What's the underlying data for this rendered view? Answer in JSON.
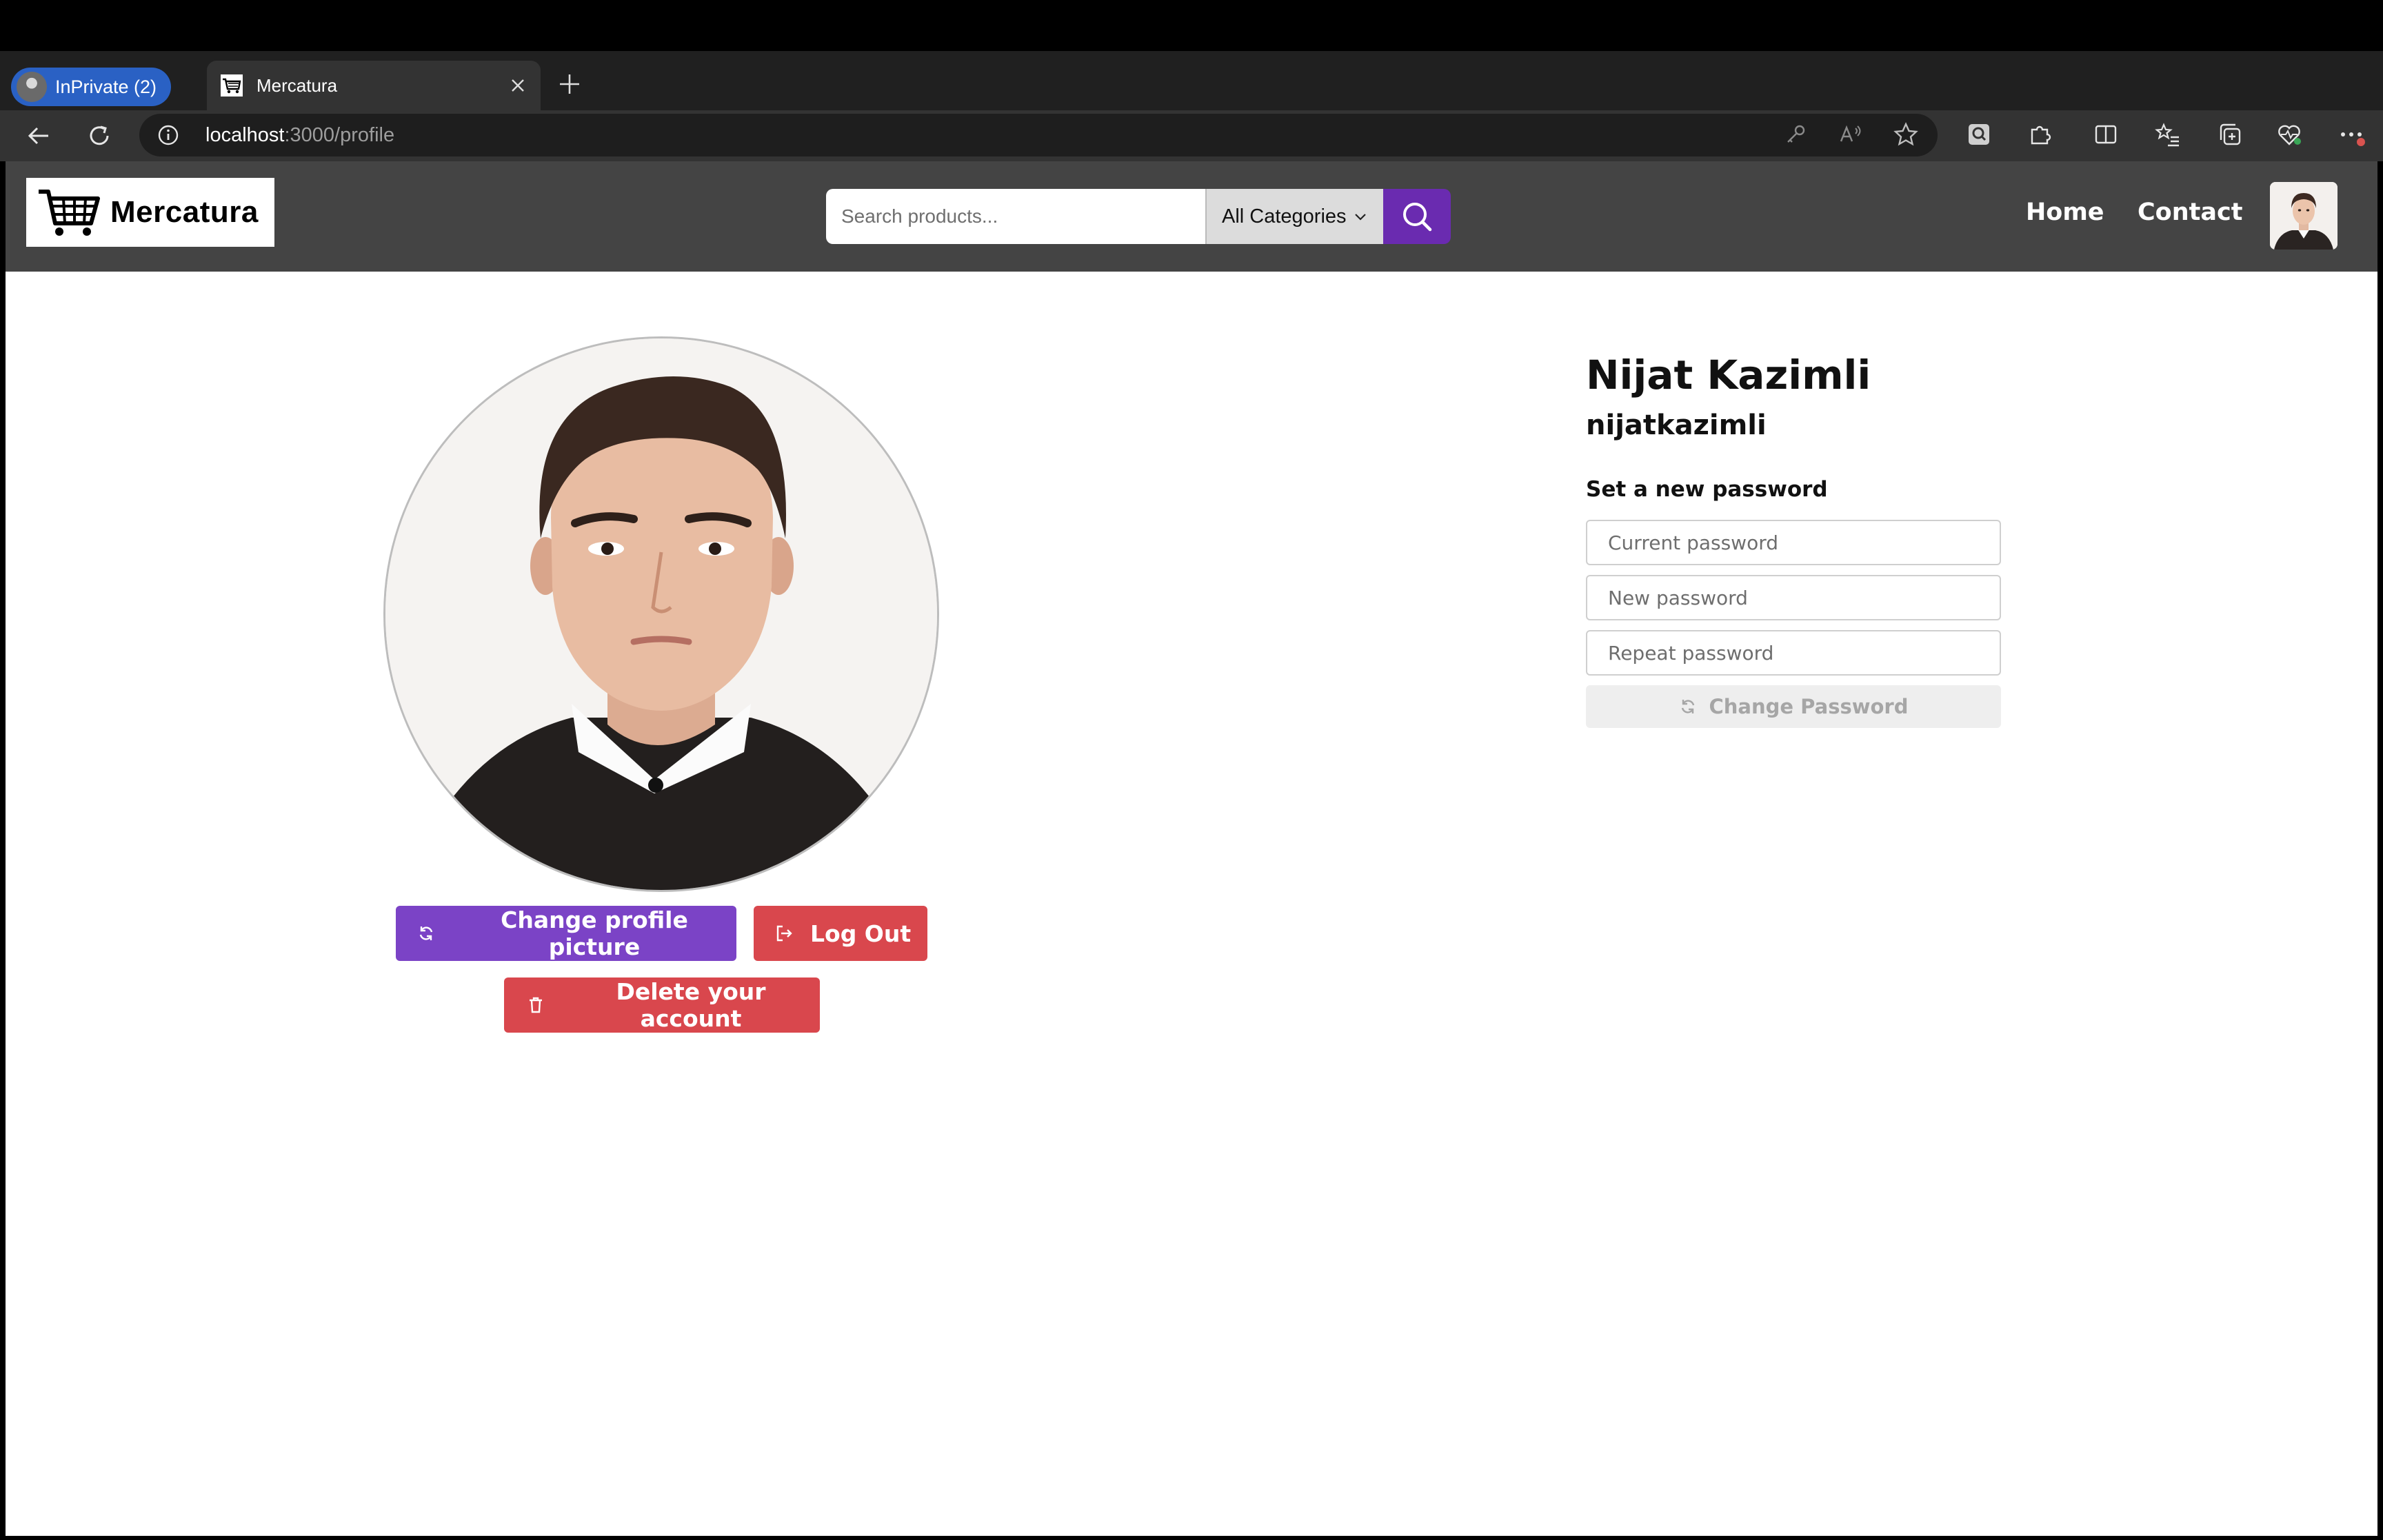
{
  "browser": {
    "profile_label": "InPrivate (2)",
    "tab_title": "Mercatura",
    "url_host": "localhost",
    "url_path": ":3000/profile"
  },
  "site": {
    "brand": "Mercatura",
    "search_placeholder": "Search products...",
    "category_selected": "All Categories",
    "nav": {
      "home": "Home",
      "contact": "Contact"
    },
    "accent_color": "#6a2bb0"
  },
  "profile": {
    "full_name": "Nijat Kazimli",
    "username": "nijatkazimli",
    "change_picture_label": "Change profile picture",
    "logout_label": "Log Out",
    "delete_label": "Delete your account"
  },
  "password_form": {
    "title": "Set a new password",
    "current_placeholder": "Current password",
    "new_placeholder": "New password",
    "repeat_placeholder": "Repeat password",
    "submit_label": "Change Password"
  },
  "icons": {
    "back": "back-arrow-icon",
    "refresh": "refresh-icon",
    "info": "info-icon",
    "cart": "shopping-cart-icon",
    "search": "search-icon",
    "sync": "sync-icon",
    "logout": "logout-icon",
    "trash": "trash-icon"
  }
}
